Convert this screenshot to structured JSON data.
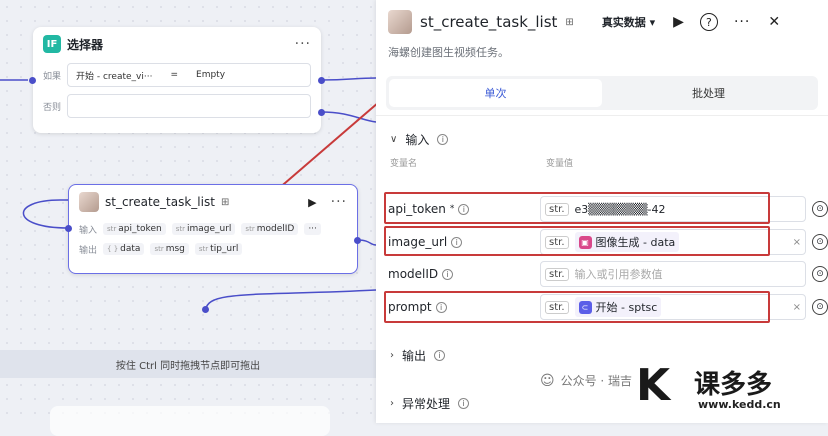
{
  "canvas": {
    "selector_node": {
      "badge": "IF",
      "title": "选择器",
      "more": "···",
      "if_label": "如果",
      "cond_left": "开始 - create_vi···",
      "cond_op": "=",
      "cond_right": "Empty",
      "else_label": "否则"
    },
    "task_node": {
      "title": "st_create_task_list",
      "more": "···",
      "input_label": "输入",
      "output_label": "输出",
      "inputs": [
        {
          "type": "str",
          "name": "api_token"
        },
        {
          "type": "str",
          "name": "image_url"
        },
        {
          "type": "str",
          "name": "modelID"
        }
      ],
      "inputs_more": "···",
      "outputs": [
        {
          "type": "{ }",
          "name": "data"
        },
        {
          "type": "str",
          "name": "msg"
        },
        {
          "type": "str",
          "name": "tip_url"
        }
      ]
    },
    "footer_hint": "按住 Ctrl 同时拖拽节点即可拖出"
  },
  "panel": {
    "title": "st_create_task_list",
    "data_select": "真实数据",
    "description": "海螺创建图生视频任务。",
    "tabs": [
      {
        "label": "单次",
        "active": true
      },
      {
        "label": "批处理",
        "active": false
      }
    ],
    "input_section": "输入",
    "col_name": "变量名",
    "col_value": "变量值",
    "params": [
      {
        "name": "api_token",
        "required": "*",
        "type": "str.",
        "value": "e3▒▒▒▒▒▒▒-42",
        "kind": "text"
      },
      {
        "name": "image_url",
        "required": "",
        "type": "str.",
        "value": "图像生成 - data",
        "kind": "ref-image"
      },
      {
        "name": "modelID",
        "required": "",
        "type": "str.",
        "value": "",
        "placeholder": "输入或引用参数值",
        "kind": "placeholder"
      },
      {
        "name": "prompt",
        "required": "",
        "type": "str.",
        "value": "开始 - sptsc",
        "kind": "ref-start"
      }
    ],
    "output_section": "输出",
    "error_section": "异常处理"
  },
  "watermark": {
    "account": "公众号 · 瑞吉",
    "logo_char": "K",
    "logo_text": "课多多",
    "logo_url": "www.kedd.cn"
  },
  "colors": {
    "highlight": "#c83a3a",
    "accent": "#3c5bd6",
    "node_border": "#6b6fe6"
  }
}
